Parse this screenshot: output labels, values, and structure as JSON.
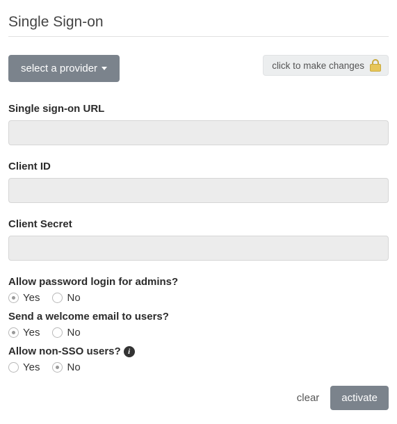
{
  "page_title": "Single Sign-on",
  "provider_button_label": "select a provider",
  "lock_label": "click to make changes",
  "fields": {
    "sso_url": {
      "label": "Single sign-on URL",
      "value": ""
    },
    "client_id": {
      "label": "Client ID",
      "value": ""
    },
    "client_secret": {
      "label": "Client Secret",
      "value": ""
    }
  },
  "radios": {
    "allow_password_admins": {
      "label": "Allow password login for admins?",
      "yes": "Yes",
      "no": "No",
      "selected": "yes"
    },
    "welcome_email": {
      "label": "Send a welcome email to users?",
      "yes": "Yes",
      "no": "No",
      "selected": "yes"
    },
    "allow_non_sso": {
      "label": "Allow non-SSO users?",
      "yes": "Yes",
      "no": "No",
      "selected": "no"
    }
  },
  "footer": {
    "clear": "clear",
    "activate": "activate"
  }
}
